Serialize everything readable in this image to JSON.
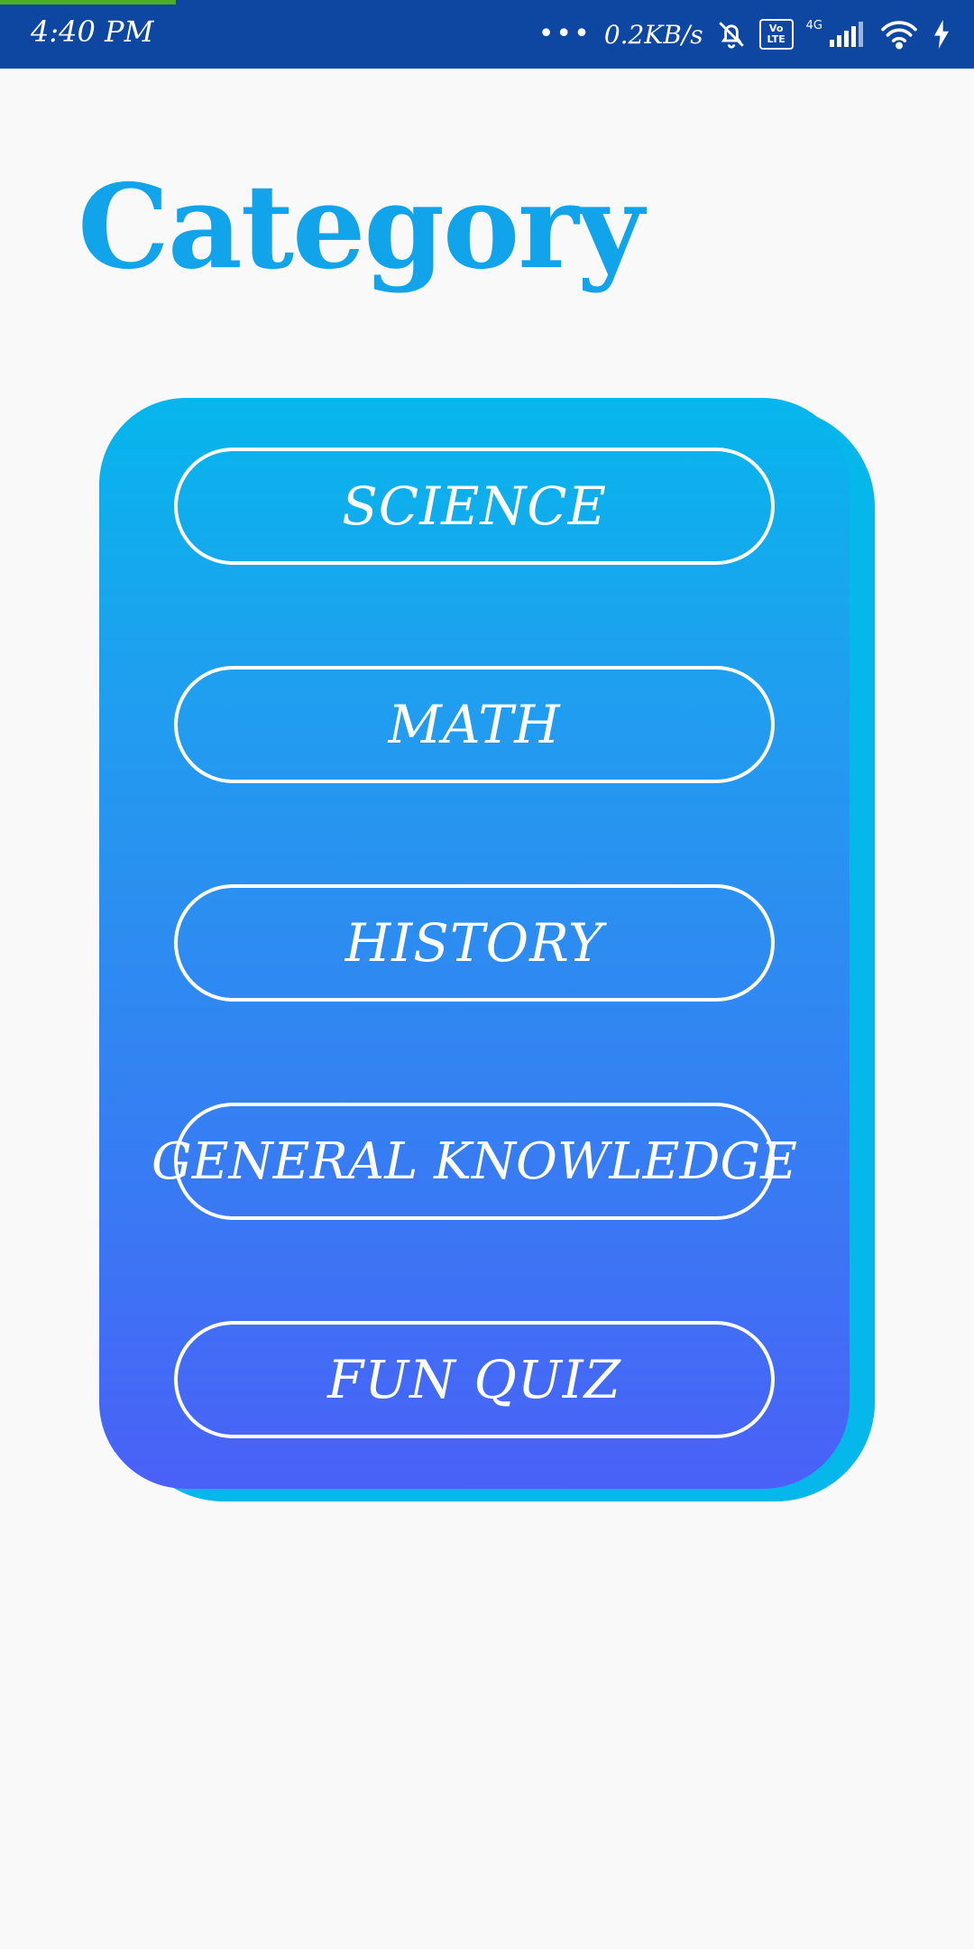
{
  "status_bar": {
    "time": "4:40 PM",
    "dots": "•••",
    "speed": "0.2KB/s",
    "volte_top": "Vo",
    "volte_bottom": "LTE",
    "network_type": "4G",
    "icons": [
      "bell-off-icon",
      "volte-icon",
      "signal-icon",
      "wifi-icon",
      "charging-icon"
    ]
  },
  "page": {
    "title": "Category"
  },
  "categories": [
    {
      "label": "SCIENCE"
    },
    {
      "label": "MATH"
    },
    {
      "label": "HISTORY"
    },
    {
      "label": "GENERAL KNOWLEDGE"
    },
    {
      "label": "FUN QUIZ"
    }
  ],
  "colors": {
    "status_bar": "#0e47a1",
    "title": "#11a4ea",
    "card_top": "#06b6ec",
    "card_bottom": "#4a60f7",
    "card_shadow": "#06b7ec",
    "background": "#f9f9f9"
  }
}
